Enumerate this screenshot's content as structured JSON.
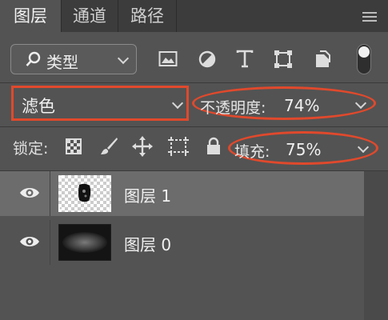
{
  "tabs": [
    {
      "label": "图层",
      "active": true
    },
    {
      "label": "通道",
      "active": false
    },
    {
      "label": "路径",
      "active": false
    }
  ],
  "filter": {
    "label": "类型",
    "icon": "search-icon"
  },
  "filter_icons": [
    "image-filter-icon",
    "adjustment-filter-icon",
    "type-filter-icon",
    "shape-filter-icon",
    "smart-object-filter-icon"
  ],
  "blend_mode": {
    "value": "滤色"
  },
  "opacity": {
    "label": "不透明度:",
    "value": "74%"
  },
  "lock": {
    "label": "锁定:",
    "icons": [
      "lock-transparent-pixels-icon",
      "lock-image-pixels-icon",
      "lock-position-icon",
      "lock-artboard-icon",
      "lock-all-icon"
    ]
  },
  "fill": {
    "label": "填充:",
    "value": "75%"
  },
  "layers": [
    {
      "name": "图层 1",
      "selected": true,
      "visible": true
    },
    {
      "name": "图层 0",
      "selected": false,
      "visible": true
    }
  ],
  "colors": {
    "highlight_annotation": "#e0492c",
    "panel_bg": "#535353",
    "selected_row": "#6c6c6c"
  }
}
